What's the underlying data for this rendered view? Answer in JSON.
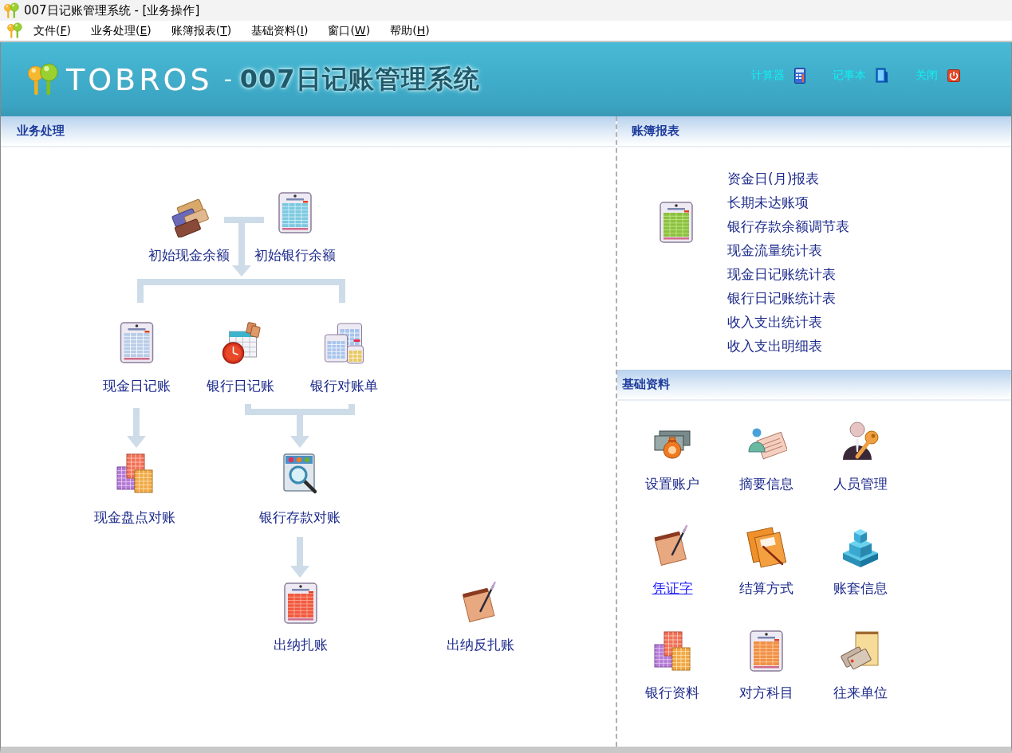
{
  "window": {
    "title": "007日记账管理系统 - [业务操作]"
  },
  "menu": [
    {
      "label": "文件(F)"
    },
    {
      "label": "业务处理(E)"
    },
    {
      "label": "账簿报表(T)"
    },
    {
      "label": "基础资料(I)"
    },
    {
      "label": "窗口(W)"
    },
    {
      "label": "帮助(H)"
    }
  ],
  "banner": {
    "brand": "TOBROS",
    "separator": "-",
    "product": "007日记账管理系统",
    "tools": [
      {
        "label": "计算器"
      },
      {
        "label": "记事本"
      },
      {
        "label": "关闭"
      }
    ]
  },
  "business": {
    "title": "业务处理",
    "nodes": [
      {
        "label": "初始现金余额",
        "hovered": false
      },
      {
        "label": "初始银行余额",
        "hovered": false
      },
      {
        "label": "现金日记账",
        "hovered": false
      },
      {
        "label": "银行日记账",
        "hovered": false
      },
      {
        "label": "银行对账单",
        "hovered": false
      },
      {
        "label": "现金盘点对账",
        "hovered": false
      },
      {
        "label": "银行存款对账",
        "hovered": false
      },
      {
        "label": "出纳扎账",
        "hovered": false
      },
      {
        "label": "出纳反扎账",
        "hovered": false
      }
    ]
  },
  "reports": {
    "title": "账簿报表",
    "items": [
      {
        "label": "资金日(月)报表"
      },
      {
        "label": "长期未达账项"
      },
      {
        "label": "银行存款余额调节表"
      },
      {
        "label": "现金流量统计表"
      },
      {
        "label": "现金日记账统计表"
      },
      {
        "label": "银行日记账统计表"
      },
      {
        "label": "收入支出统计表"
      },
      {
        "label": "收入支出明细表"
      }
    ]
  },
  "basics": {
    "title": "基础资料",
    "items": [
      {
        "label": "设置账户",
        "hovered": false
      },
      {
        "label": "摘要信息",
        "hovered": false
      },
      {
        "label": "人员管理",
        "hovered": false
      },
      {
        "label": "凭证字",
        "hovered": true
      },
      {
        "label": "结算方式",
        "hovered": false
      },
      {
        "label": "账套信息",
        "hovered": false
      },
      {
        "label": "银行资料",
        "hovered": false
      },
      {
        "label": "对方科目",
        "hovered": false
      },
      {
        "label": "往来单位",
        "hovered": false
      }
    ]
  }
}
